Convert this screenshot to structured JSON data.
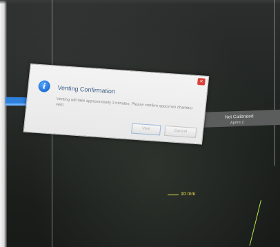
{
  "dialog": {
    "title": "Venting Confirmation",
    "message": "Venting will take approximately 3 minutes. Please confirm specimen chamber vent.",
    "icon": "info-icon",
    "close_label": "×",
    "buttons": {
      "vent": "Vent",
      "cancel": "Cancel"
    }
  },
  "info_panel": {
    "status": "Not Calibrated",
    "aperture": "Aprtre 2"
  },
  "scale": {
    "label": "10 mm"
  },
  "colors": {
    "accent_blue": "#2f7fdc",
    "scale_yellow": "#f0e84a",
    "close_red": "#d9413b"
  }
}
